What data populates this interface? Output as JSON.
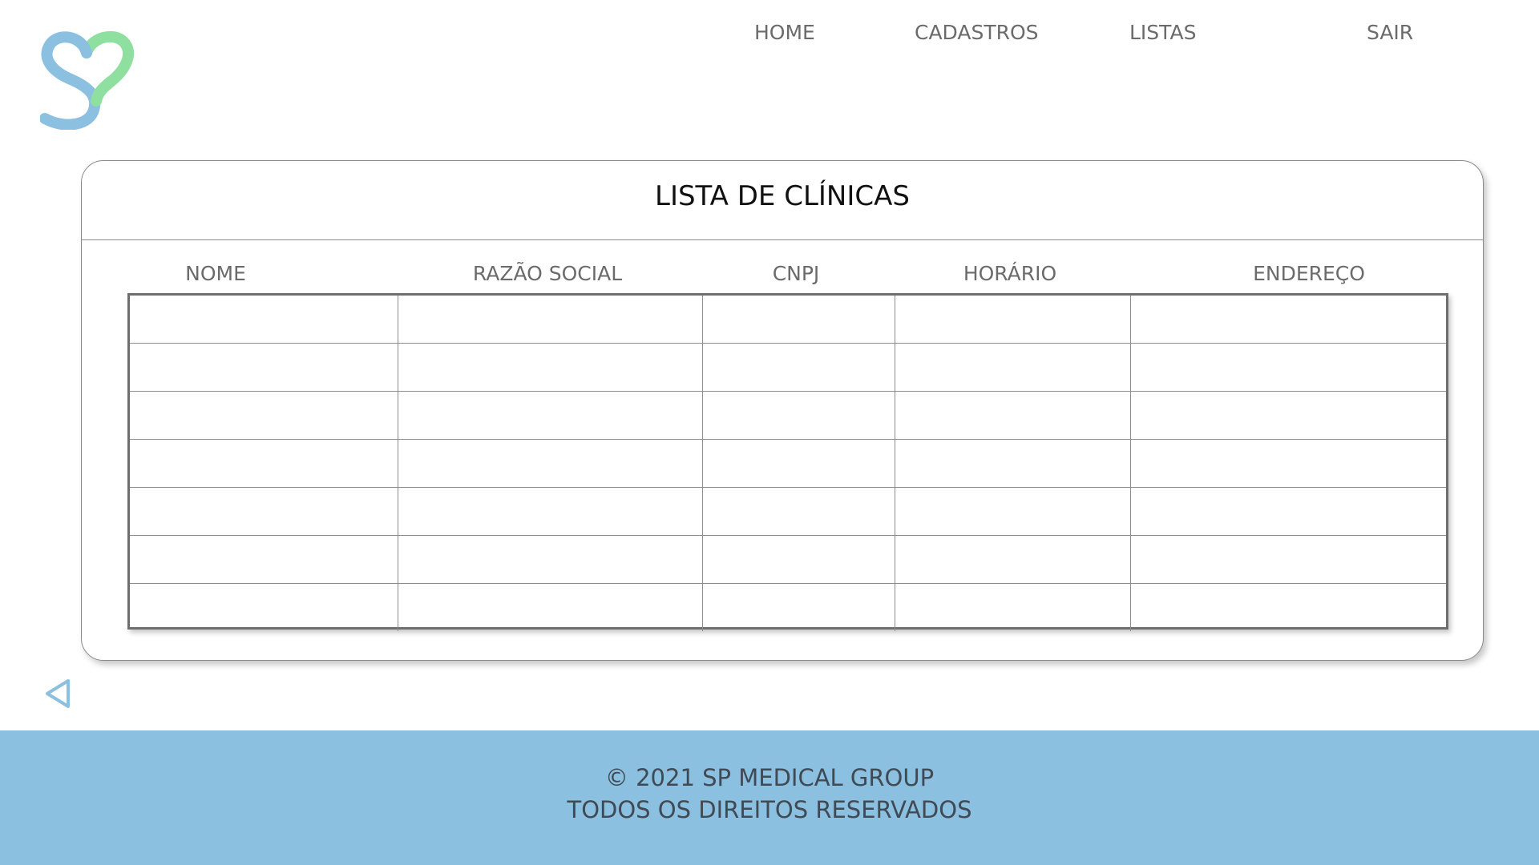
{
  "header": {
    "nav": {
      "home": "HOME",
      "cadastros": "CADASTROS",
      "listas": "LISTAS",
      "sair": "SAIR"
    }
  },
  "main": {
    "title": "LISTA DE CLÍNICAS",
    "table": {
      "columns": [
        "NOME",
        "RAZÃO SOCIAL",
        "CNPJ",
        "HORÁRIO",
        "ENDEREÇO"
      ],
      "rows": [
        [
          "",
          "",
          "",
          "",
          ""
        ],
        [
          "",
          "",
          "",
          "",
          ""
        ],
        [
          "",
          "",
          "",
          "",
          ""
        ],
        [
          "",
          "",
          "",
          "",
          ""
        ],
        [
          "",
          "",
          "",
          "",
          ""
        ],
        [
          "",
          "",
          "",
          "",
          ""
        ],
        [
          "",
          "",
          "",
          "",
          ""
        ]
      ]
    }
  },
  "back": {
    "icon": "back-arrow-icon"
  },
  "footer": {
    "line1": "© 2021 SP MEDICAL GROUP",
    "line2": "TODOS OS DIREITOS RESERVADOS"
  },
  "colors": {
    "logo_blue": "#8bc0e0",
    "logo_green": "#8fe0a0",
    "footer_bg": "#8bc0e0",
    "nav_text": "#6b6b6b"
  }
}
